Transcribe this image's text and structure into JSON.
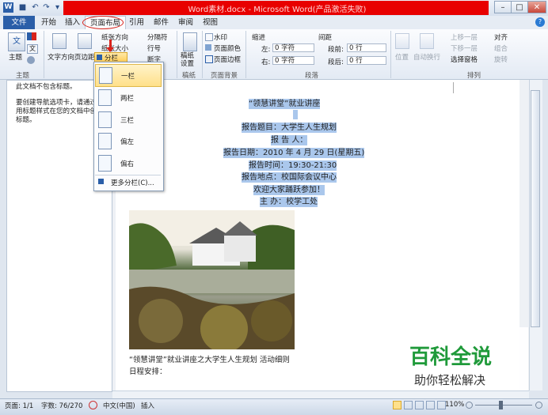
{
  "titlebar": {
    "title": "Word素材.docx - Microsoft Word(产品激活失败)",
    "minimize": "–",
    "maximize": "□",
    "close": "✕"
  },
  "tabs": [
    {
      "label": "文件"
    },
    {
      "label": "开始"
    },
    {
      "label": "插入"
    },
    {
      "label": "页面布局"
    },
    {
      "label": "引用"
    },
    {
      "label": "邮件"
    },
    {
      "label": "审阅"
    },
    {
      "label": "视图"
    }
  ],
  "ribbon": {
    "theme": {
      "label": "主题",
      "group": "主题"
    },
    "page_setup": {
      "text_direction": "文字方向",
      "margins": "页边距",
      "orientation": "纸张方向",
      "size": "纸张大小",
      "columns": "分栏",
      "breaks": "分隔符",
      "line_numbers": "行号",
      "hyphenation": "断字"
    },
    "draft": {
      "label": "稿纸设置",
      "group": "稿纸"
    },
    "background": {
      "watermark": "水印",
      "page_color": "页面颜色",
      "page_borders": "页面边框",
      "group": "页面背景"
    },
    "paragraph": {
      "indent_label": "缩进",
      "spacing_label": "间距",
      "left": "左:",
      "left_value": "0 字符",
      "right": "右:",
      "right_value": "0 字符",
      "before": "段前:",
      "before_value": "0 行",
      "after": "段后:",
      "after_value": "0 行",
      "group": "段落"
    },
    "arrange": {
      "position": "位置",
      "wrap": "自动换行",
      "bring_forward": "上移一层",
      "send_backward": "下移一层",
      "selection_pane": "选择窗格",
      "align": "对齐",
      "group_btn": "组合",
      "rotate": "旋转",
      "group": "排列"
    }
  },
  "navpane": {
    "line1": "此文档不包含标题。",
    "line2": "要创建导航选项卡，请通过应",
    "line3": "用标题样式在您的文档中创建",
    "line4": "标题。"
  },
  "dropdown": {
    "items": [
      {
        "label": "一栏"
      },
      {
        "label": "两栏"
      },
      {
        "label": "三栏"
      },
      {
        "label": "偏左"
      },
      {
        "label": "偏右"
      }
    ],
    "more": "更多分栏(C)..."
  },
  "document": {
    "lines": [
      "“领慧讲堂”就业讲座",
      "",
      "报告题目：大学生人生规划",
      "报 告 人：",
      "报告日期：2010 年 4 月 29 日(星期五)",
      "报告时间：19:30-21:30",
      "报告地点：校国际会议中心",
      "欢迎大家踊跃参加！",
      "主 办：校学工处"
    ],
    "body1": "“领慧讲堂”就业讲座之大学生人生规划  活动细则",
    "body2": "日程安排："
  },
  "status": {
    "page": "页面: 1/1",
    "words": "字数: 76/270",
    "lang": "中文(中国)",
    "mode": "插入",
    "zoom": "110%"
  },
  "watermark": {
    "title": "百科全说",
    "subtitle": "助你轻松解决"
  }
}
